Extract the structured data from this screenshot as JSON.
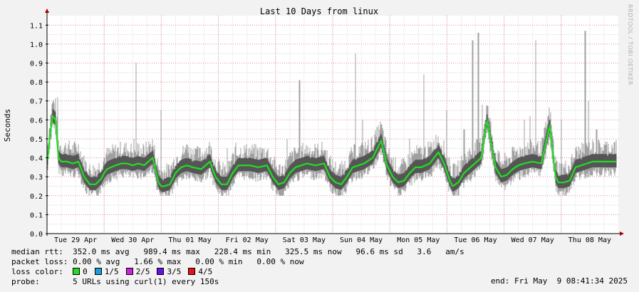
{
  "chart_data": {
    "type": "line",
    "title": "Last 10 Days from linux",
    "ylabel": "Seconds",
    "xlabel": "",
    "ylim": [
      0,
      1.15
    ],
    "yticks": [
      "0.0",
      "0.1",
      "0.2",
      "0.3",
      "0.4",
      "0.5",
      "0.6",
      "0.7",
      "0.8",
      "0.9",
      "1.0",
      "1.1"
    ],
    "ytick_values": [
      0,
      0.1,
      0.2,
      0.3,
      0.4,
      0.5,
      0.6,
      0.7,
      0.8,
      0.9,
      1.0,
      1.1
    ],
    "xticks": [
      "Tue 29 Apr",
      "Wed 30 Apr",
      "Thu 01 May",
      "Fri 02 May",
      "Sat 03 May",
      "Sun 04 May",
      "Mon 05 May",
      "Tue 06 May",
      "Wed 07 May",
      "Thu 08 May"
    ],
    "grid": true,
    "series": [
      {
        "name": "median rtt",
        "color": "#22dd22",
        "x_days": [
          0,
          0.05,
          0.1,
          0.15,
          0.2,
          0.25,
          0.35,
          0.45,
          0.55,
          0.65,
          0.75,
          0.85,
          0.95,
          1.0,
          1.05,
          1.12,
          1.2,
          1.3,
          1.4,
          1.5,
          1.6,
          1.7,
          1.85,
          1.95,
          2.0,
          2.05,
          2.15,
          2.25,
          2.35,
          2.45,
          2.55,
          2.7,
          2.85,
          2.95,
          3.05,
          3.15,
          3.25,
          3.35,
          3.45,
          3.55,
          3.7,
          3.85,
          3.95,
          4.05,
          4.15,
          4.25,
          4.35,
          4.45,
          4.55,
          4.7,
          4.85,
          4.95,
          5.05,
          5.15,
          5.25,
          5.35,
          5.45,
          5.55,
          5.7,
          5.85,
          5.95,
          6.05,
          6.15,
          6.25,
          6.35,
          6.45,
          6.55,
          6.7,
          6.85,
          6.95,
          7.05,
          7.1,
          7.2,
          7.3,
          7.45,
          7.6,
          7.7,
          7.85,
          7.95,
          8.05,
          8.15,
          8.25,
          8.35,
          8.5,
          8.65,
          8.8,
          8.9,
          8.95,
          9.05,
          9.15,
          9.25,
          9.35,
          9.45,
          9.55,
          9.65
        ],
        "values": [
          0.35,
          0.52,
          0.62,
          0.6,
          0.4,
          0.38,
          0.38,
          0.37,
          0.38,
          0.3,
          0.26,
          0.26,
          0.29,
          0.32,
          0.34,
          0.35,
          0.36,
          0.37,
          0.37,
          0.36,
          0.37,
          0.36,
          0.4,
          0.27,
          0.25,
          0.25,
          0.26,
          0.32,
          0.35,
          0.36,
          0.35,
          0.34,
          0.38,
          0.3,
          0.26,
          0.26,
          0.32,
          0.36,
          0.36,
          0.36,
          0.35,
          0.36,
          0.3,
          0.26,
          0.27,
          0.32,
          0.35,
          0.36,
          0.37,
          0.36,
          0.37,
          0.3,
          0.27,
          0.26,
          0.3,
          0.35,
          0.36,
          0.37,
          0.4,
          0.49,
          0.36,
          0.3,
          0.27,
          0.28,
          0.32,
          0.35,
          0.35,
          0.37,
          0.43,
          0.37,
          0.28,
          0.25,
          0.27,
          0.32,
          0.36,
          0.4,
          0.6,
          0.35,
          0.3,
          0.31,
          0.34,
          0.36,
          0.37,
          0.38,
          0.37,
          0.57,
          0.3,
          0.27,
          0.27,
          0.28,
          0.35,
          0.36,
          0.37,
          0.38,
          0.38
        ]
      }
    ]
  },
  "stats": {
    "rtt_label": "median rtt:",
    "rtt_values": "352.0 ms avg   989.4 ms max   228.4 ms min   325.5 ms now   96.6 ms sd   3.6   am/s",
    "loss_label": "packet loss:",
    "loss_values": "0.00 % avg   1.66 % max   0.00 % min   0.00 % now",
    "color_label": "loss color:",
    "probe_label": "probe:",
    "probe_text": "5 URLs using curl(1) every 150s",
    "end_text": "end: Fri May  9 08:41:34 2025"
  },
  "loss_colors": [
    {
      "label": "0",
      "color": "#22dd22"
    },
    {
      "label": "1/5",
      "color": "#1e9cd8"
    },
    {
      "label": "2/5",
      "color": "#cc22dd"
    },
    {
      "label": "3/5",
      "color": "#6611ee"
    },
    {
      "label": "4/5",
      "color": "#ee1111"
    }
  ],
  "watermark": "RRDTOOL / TOBI OETIKER"
}
